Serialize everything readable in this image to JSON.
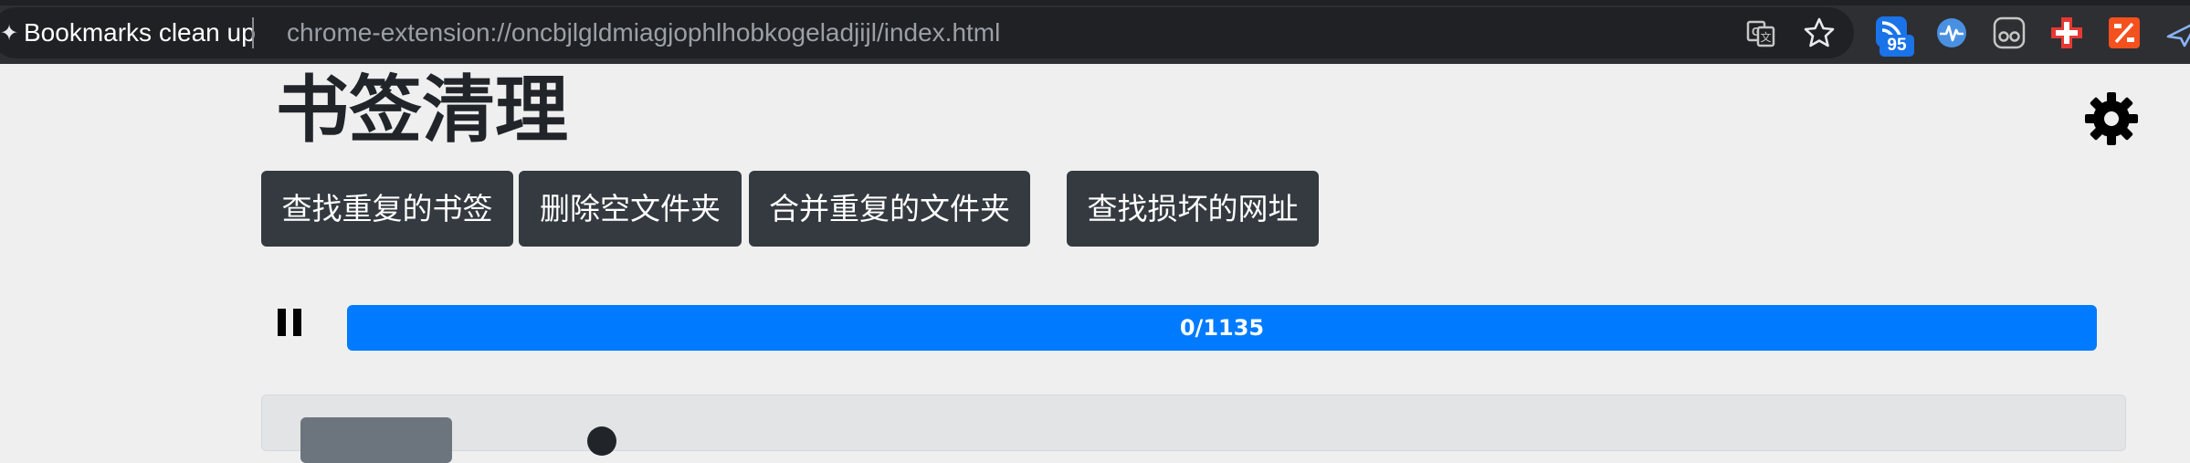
{
  "browser": {
    "tab_title": "Bookmarks clean up",
    "url": "chrome-extension://oncbjlgldmiagjophlhobkogeladjijl/index.html",
    "omnibox_icons": [
      "translate-icon",
      "bookmark-star-icon"
    ],
    "extensions": [
      {
        "icon": "rss-feed-extension-icon",
        "badge": "95"
      },
      {
        "icon": "pulse-extension-icon"
      },
      {
        "icon": "reader-extension-icon"
      },
      {
        "icon": "plus-cross-extension-icon"
      },
      {
        "icon": "percent-extension-icon"
      },
      {
        "icon": "plane-extension-icon"
      }
    ],
    "colors": {
      "toolbar": "#2e2f32",
      "omnibox": "#202124",
      "url_text": "#9aa0a6",
      "badge": "#1a73e8"
    }
  },
  "page": {
    "title": "书签清理",
    "settings_icon": "gear-icon",
    "actions": [
      {
        "label": "查找重复的书签"
      },
      {
        "label": "删除空文件夹"
      },
      {
        "label": "合并重复的文件夹"
      },
      {
        "label": "查找损坏的网址"
      }
    ],
    "progress": {
      "current": 0,
      "total": 1135,
      "label": "0/1135",
      "fill_fraction": 1.0
    },
    "pause_icon": "pause-icon",
    "colors": {
      "background": "#efefef",
      "button": "#343a40",
      "progress": "#007bff",
      "text": "#212529"
    }
  }
}
